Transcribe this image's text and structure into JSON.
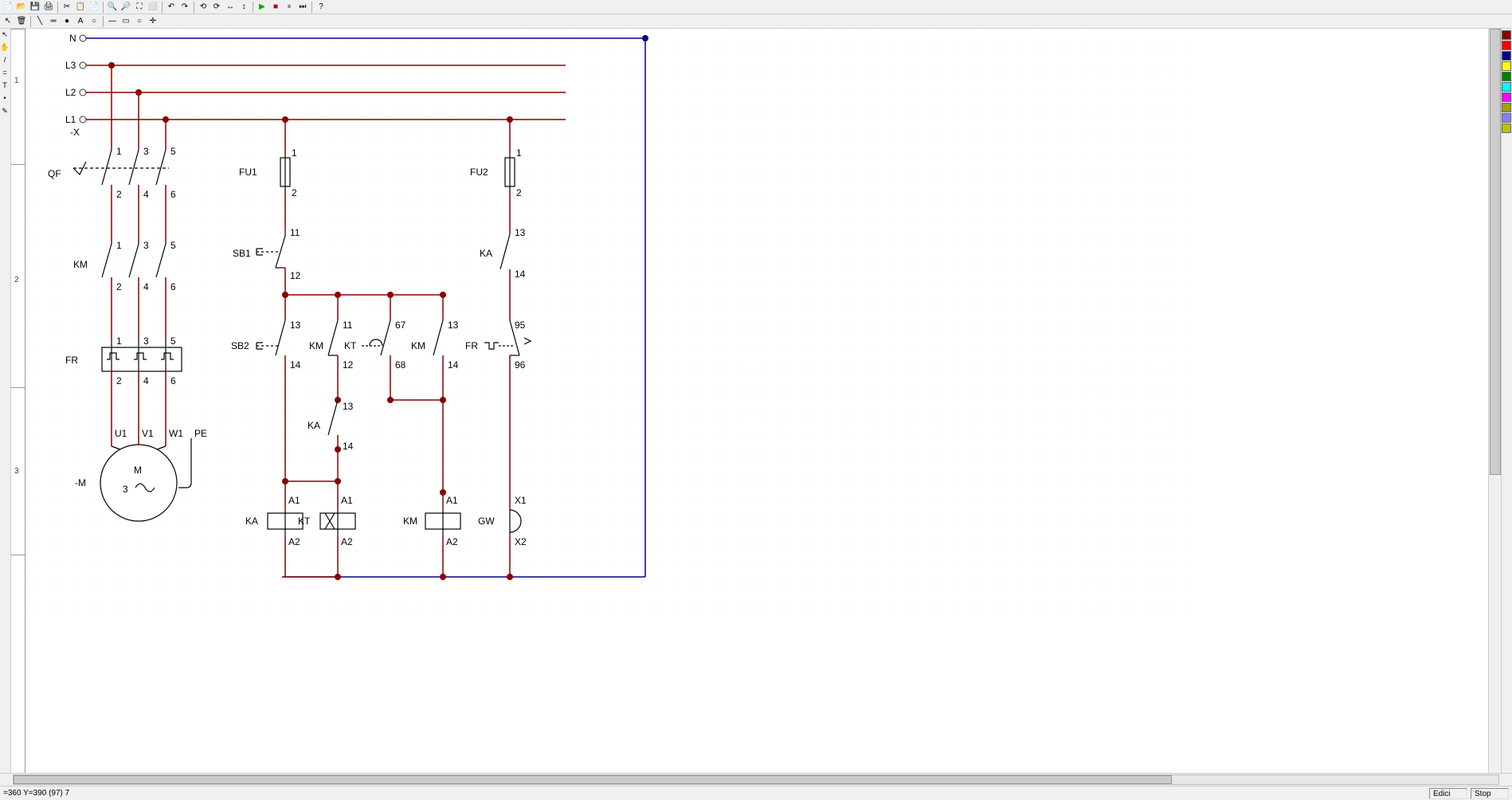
{
  "status": {
    "coords": "=360 Y=390 (97) 7",
    "mode": "Edici",
    "sim": "Stop"
  },
  "ruler": {
    "marks": [
      "1",
      "2",
      "3"
    ]
  },
  "palette": [
    "#8B0000",
    "#FF0000",
    "#00008B",
    "#FFFF00",
    "#008000",
    "#00FFFF",
    "#FF00FF",
    "#A0A000",
    "#8080FF",
    "#C0C000"
  ],
  "schematic": {
    "bus": {
      "N": "N",
      "L3": "L3",
      "L2": "L2",
      "L1": "L1",
      "X": "-X"
    },
    "components": {
      "QF": {
        "name": "QF",
        "t1": "1",
        "t2": "2",
        "t3": "3",
        "t4": "4",
        "t5": "5",
        "t6": "6"
      },
      "KM_main": {
        "name": "KM",
        "t1": "1",
        "t2": "2",
        "t3": "3",
        "t4": "4",
        "t5": "5",
        "t6": "6"
      },
      "FR_main": {
        "name": "FR",
        "t1": "1",
        "t2": "2",
        "t3": "3",
        "t4": "4",
        "t5": "5",
        "t6": "6"
      },
      "motor": {
        "ref": "-M",
        "M": "M",
        "three": "3",
        "U1": "U1",
        "V1": "V1",
        "W1": "W1",
        "PE": "PE"
      },
      "FU1": {
        "name": "FU1",
        "t1": "1",
        "t2": "2"
      },
      "FU2": {
        "name": "FU2",
        "t1": "1",
        "t2": "2"
      },
      "SB1": {
        "name": "SB1",
        "t1": "11",
        "t2": "12"
      },
      "SB2": {
        "name": "SB2",
        "t1": "13",
        "t2": "14"
      },
      "KM_aux1": {
        "name": "KM",
        "t1": "11",
        "t2": "12"
      },
      "KT_ct": {
        "name": "KT",
        "t1": "67",
        "t2": "68"
      },
      "KM_aux2": {
        "name": "KM",
        "t1": "13",
        "t2": "14"
      },
      "KA_ct": {
        "name": "KA",
        "t1": "13",
        "t2": "14"
      },
      "KA_aux": {
        "name": "KA",
        "t1": "13",
        "t2": "14"
      },
      "FR_aux": {
        "name": "FR",
        "t1": "95",
        "t2": "96"
      },
      "KA_coil": {
        "name": "KA",
        "A1": "A1",
        "A2": "A2"
      },
      "KT_coil": {
        "name": "KT",
        "A1": "A1",
        "A2": "A2"
      },
      "KM_coil": {
        "name": "KM",
        "A1": "A1",
        "A2": "A2"
      },
      "GW": {
        "name": "GW",
        "X1": "X1",
        "X2": "X2"
      }
    }
  }
}
